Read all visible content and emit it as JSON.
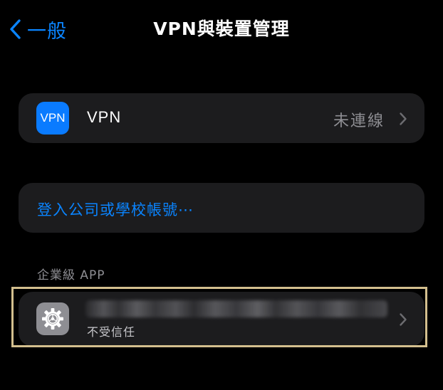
{
  "nav": {
    "back_label": "一般",
    "title": "VPN與裝置管理",
    "accent_color": "#0a84ff"
  },
  "vpn_row": {
    "icon_text": "VPN",
    "label": "VPN",
    "status": "未連線",
    "icon_color": "#0a7bff"
  },
  "signin_row": {
    "label": "登入公司或學校帳號⋯"
  },
  "enterprise_section": {
    "header": "企業級 APP",
    "app": {
      "icon": "gear-icon",
      "name": "",
      "subtitle": "不受信任"
    }
  },
  "colors": {
    "background": "#000000",
    "cell_background": "#1c1c1e",
    "secondary_text": "#8e8e93",
    "highlight_frame": "#d3bf8e"
  }
}
